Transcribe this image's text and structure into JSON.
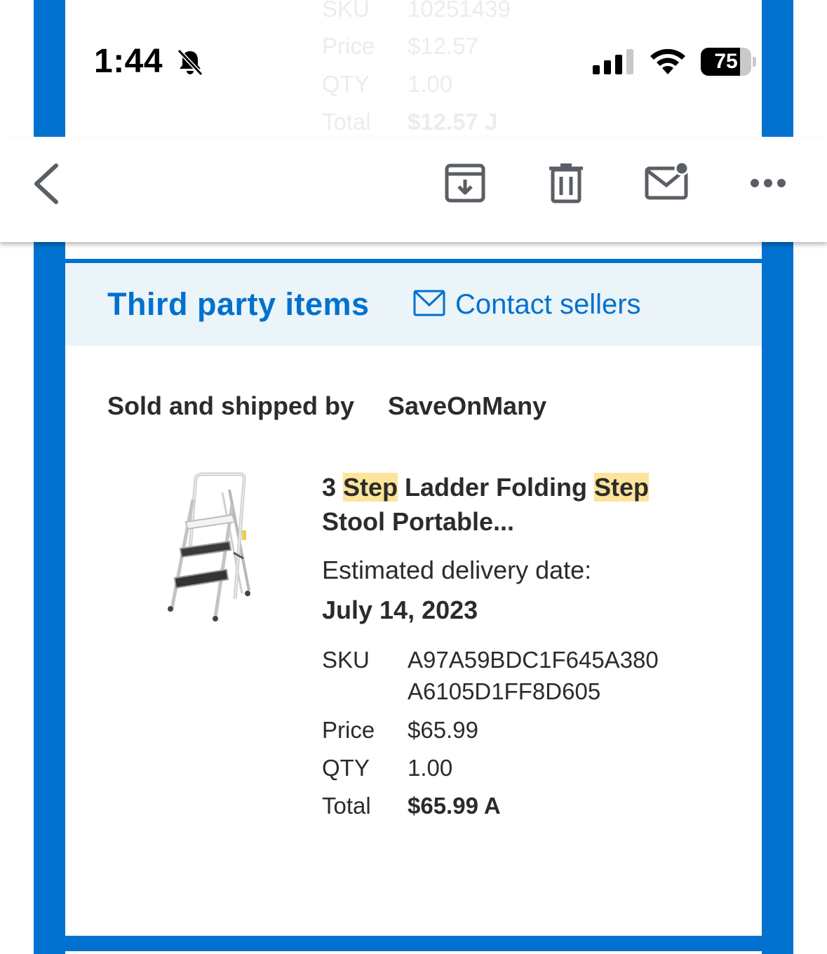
{
  "status_bar": {
    "time": "1:44",
    "battery": "75",
    "icons": [
      "bell-slash-icon",
      "signal-icon",
      "wifi-icon",
      "battery-icon"
    ]
  },
  "previous_item": {
    "sku_label": "SKU",
    "sku_value": "10251439",
    "price_label": "Price",
    "price_value": "$12.57",
    "qty_label": "QTY",
    "qty_value": "1.00",
    "total_label": "Total",
    "total_value": "$12.57 J"
  },
  "toolbar": {
    "icons": [
      "back-chevron-icon",
      "archive-icon",
      "trash-icon",
      "mark-unread-icon",
      "more-icon"
    ]
  },
  "section": {
    "title": "Third party items",
    "contact_label": "Contact sellers"
  },
  "seller": {
    "prefix": "Sold and shipped by",
    "name": "SaveOnMany"
  },
  "product": {
    "title_parts": [
      "3 ",
      "Step",
      " Ladder Folding ",
      "Step",
      " Stool Portable..."
    ],
    "delivery_label": "Estimated delivery date:",
    "delivery_date": "July 14, 2023",
    "sku_label": "SKU",
    "sku_line1": "A97A59BDC1F645A380",
    "sku_line2": "A6105D1FF8D605",
    "price_label": "Price",
    "price_value": "$65.99",
    "qty_label": "QTY",
    "qty_value": "1.00",
    "total_label": "Total",
    "total_value": "$65.99 A"
  },
  "colors": {
    "brand_blue": "#0071ce",
    "band_bg": "#ebf4f8",
    "highlight": "#fde49a"
  }
}
